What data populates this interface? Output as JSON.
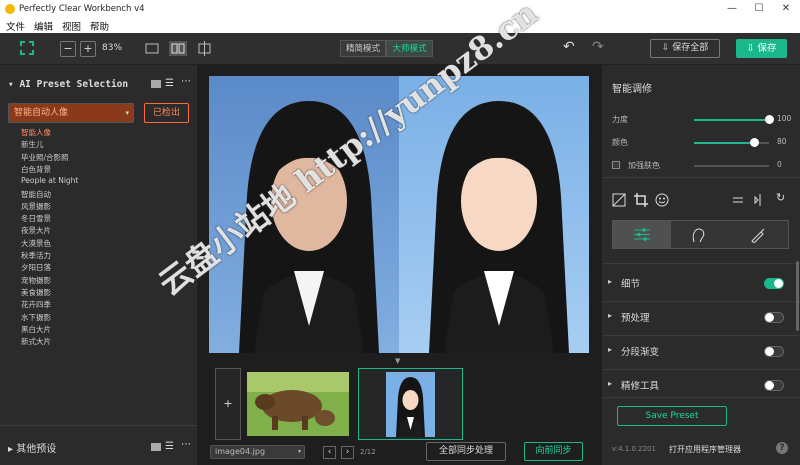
{
  "window": {
    "title": "Perfectly Clear Workbench v4",
    "minimize": "—",
    "maximize": "☐",
    "close": "✕"
  },
  "menu": [
    "文件",
    "编辑",
    "视图",
    "帮助"
  ],
  "toolbar": {
    "zoom_out": "−",
    "zoom_in": "+",
    "zoom": "83%",
    "mode_simple": "精简模式",
    "mode_large": "大师模式",
    "undo": "↶",
    "redo": "↷",
    "save_all": "保存全部",
    "save": "保存"
  },
  "left": {
    "title": "AI Preset Selection",
    "selected": "智能自动人像",
    "detected_button": "已检出",
    "presets": [
      "智能人像",
      "新生儿",
      "毕业照/合影照",
      "白色背景",
      "People at Night",
      "智能自动",
      "风景摄影",
      "冬日雪景",
      "夜景大片",
      "大漠景色",
      "秋季活力",
      "夕阳日落",
      "宠物摄影",
      "美食摄影",
      "花卉四季",
      "水下摄影",
      "黑白大片",
      "新式大片"
    ],
    "other_presets": "其他预设"
  },
  "center": {
    "add": "+",
    "filename": "image04.jpg",
    "page": "2/12",
    "sync_all": "全部同步处理",
    "sync_forward": "向前同步",
    "nav_prev": "‹",
    "nav_next": "›"
  },
  "right": {
    "header": "智能调修",
    "sliders": [
      {
        "label": "力度",
        "value": "100",
        "fraction": 1.0
      },
      {
        "label": "颜色",
        "value": "80",
        "fraction": 0.8
      },
      {
        "label": "加强肤色",
        "value": "0",
        "fraction": 0.0
      }
    ],
    "sections": [
      {
        "label": "细节",
        "on": true
      },
      {
        "label": "预处理",
        "on": false
      },
      {
        "label": "分段渐变",
        "on": false
      },
      {
        "label": "精修工具",
        "on": false
      }
    ],
    "save_preset": "Save Preset",
    "version": "v:4.1.0.2201",
    "open_manager": "打开应用程序管理器",
    "help": "?"
  },
  "watermark": {
    "line1": "云盘小站地 http://yunpz8.cn"
  },
  "colors": {
    "accent": "#1bb88d",
    "preset_bg": "#8a3a1a",
    "preset_text": "#ff8a5a",
    "detected": "#ff6a3a"
  }
}
